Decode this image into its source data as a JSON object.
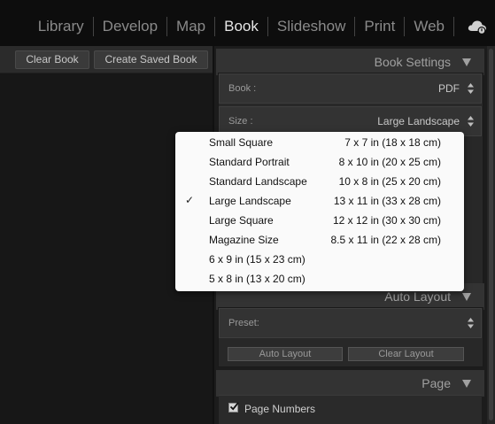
{
  "modules": [
    "Library",
    "Develop",
    "Map",
    "Book",
    "Slideshow",
    "Print",
    "Web"
  ],
  "active_module": "Book",
  "cloud_icon": "cloud-sync-icon",
  "toolbar": {
    "clear_book": "Clear Book",
    "create_saved_book": "Create Saved Book"
  },
  "panels": {
    "book_settings": {
      "title": "Book Settings",
      "book_label": "Book :",
      "book_value": "PDF",
      "size_label": "Size :",
      "size_value": "Large Landscape"
    },
    "auto_layout": {
      "title": "Auto Layout",
      "preset_label": "Preset:",
      "auto_layout_button": "Auto Layout",
      "clear_layout_button": "Clear Layout"
    },
    "page": {
      "title": "Page",
      "page_numbers_label": "Page Numbers",
      "page_numbers_checked": true
    }
  },
  "size_dropdown": {
    "selected": "Large Landscape",
    "check_mark": "✓",
    "options": [
      {
        "name": "Small Square",
        "dims": "7 x 7 in (18 x 18 cm)"
      },
      {
        "name": "Standard Portrait",
        "dims": "8 x 10 in (20 x 25 cm)"
      },
      {
        "name": "Standard Landscape",
        "dims": "10 x 8 in (25 x 20 cm)"
      },
      {
        "name": "Large Landscape",
        "dims": "13 x 11 in (33 x 28 cm)"
      },
      {
        "name": "Large Square",
        "dims": "12 x 12 in (30 x 30 cm)"
      },
      {
        "name": "Magazine Size",
        "dims": "8.5 x 11 in (22 x 28 cm)"
      },
      {
        "name": "6 x 9 in (15 x 23 cm)",
        "dims": ""
      },
      {
        "name": "5 x 8 in (13 x 20 cm)",
        "dims": ""
      }
    ]
  },
  "colors": {
    "panel_bg": "#1c1c1c",
    "header_bg": "#333333",
    "menu_bg": "#fafafa",
    "active_text": "#e6e6e6",
    "inactive_text": "#8a8a8a"
  }
}
